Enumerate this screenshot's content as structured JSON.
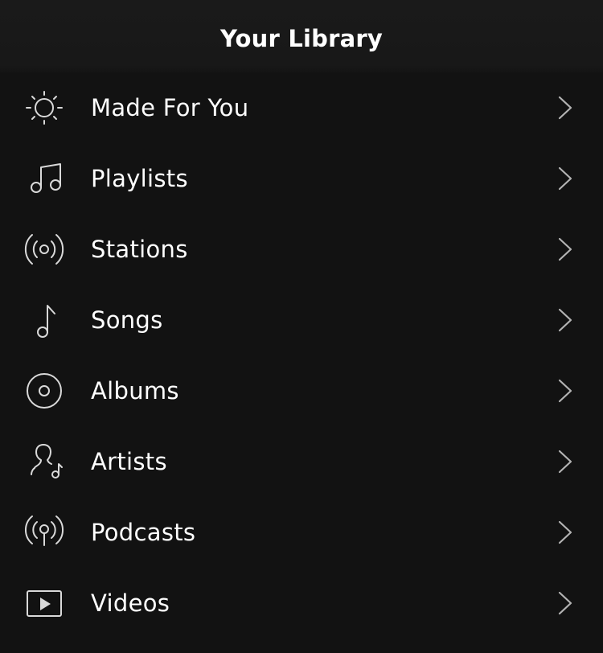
{
  "header": {
    "title": "Your Library"
  },
  "colors": {
    "header_bg": "#181818",
    "list_bg": "#121212",
    "text": "#ffffff",
    "icon": "#d9d9d9",
    "chevron": "#b3b3b3"
  },
  "items": [
    {
      "label": "Made For You",
      "icon": "sun-icon"
    },
    {
      "label": "Playlists",
      "icon": "double-music-note-icon"
    },
    {
      "label": "Stations",
      "icon": "radio-waves-icon"
    },
    {
      "label": "Songs",
      "icon": "music-note-icon"
    },
    {
      "label": "Albums",
      "icon": "album-disc-icon"
    },
    {
      "label": "Artists",
      "icon": "artist-person-note-icon"
    },
    {
      "label": "Podcasts",
      "icon": "podcast-antenna-icon"
    },
    {
      "label": "Videos",
      "icon": "video-play-icon"
    }
  ]
}
